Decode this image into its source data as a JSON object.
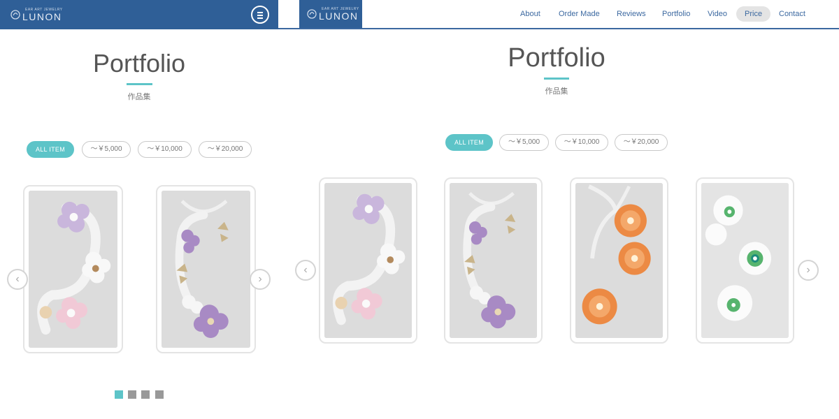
{
  "brand": {
    "tagline": "EAR ART JEWELRY",
    "name": "LUNON"
  },
  "colors": {
    "header_blue": "#2f5f97",
    "accent_teal": "#5dc4c8",
    "nav_text": "#3b68a0"
  },
  "nav": {
    "items": [
      {
        "label": "About"
      },
      {
        "label": "Order Made"
      },
      {
        "label": "Reviews"
      },
      {
        "label": "Portfolio"
      },
      {
        "label": "Video"
      },
      {
        "label": "Price",
        "active": true
      },
      {
        "label": "Contact"
      }
    ]
  },
  "section": {
    "title": "Portfolio",
    "subtitle": "作品集"
  },
  "filters": [
    {
      "label": "ALL ITEM",
      "active": true
    },
    {
      "label": "～￥5,000"
    },
    {
      "label": "～￥10,000"
    },
    {
      "label": "～￥20,000"
    }
  ],
  "portfolio_items": [
    {
      "image": "lilac-and-pink-flower-ear-cuff-icon",
      "palette": "purple-pink"
    },
    {
      "image": "purple-flower-butterfly-ear-cuff-icon",
      "palette": "purple"
    },
    {
      "image": "orange-flower-ear-cuff-icon",
      "palette": "orange"
    },
    {
      "image": "white-green-flower-ear-cuff-icon",
      "palette": "white-green"
    }
  ],
  "carousel": {
    "prev_icon": "chevron-left-icon",
    "next_icon": "chevron-right-icon",
    "pages": 4,
    "current_page": 1
  },
  "menu": {
    "icon": "hamburger-menu-icon"
  }
}
